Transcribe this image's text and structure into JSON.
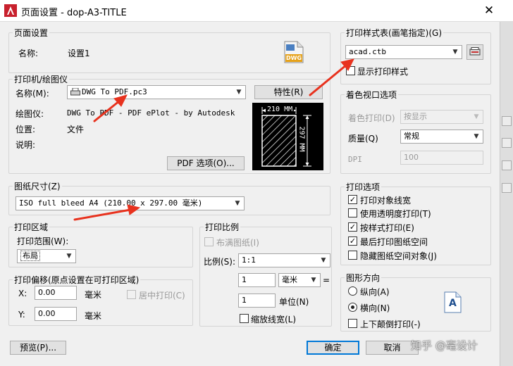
{
  "window": {
    "title": "页面设置 - dop-A3-TITLE",
    "close_glyph": "✕"
  },
  "page_setup": {
    "legend": "页面设置",
    "name_label": "名称:",
    "name_value": "设置1",
    "icon_badge": "DWG"
  },
  "printer": {
    "legend": "打印机/绘图仪",
    "name_label": "名称(M):",
    "name_value": "DWG To PDF.pc3",
    "properties_button": "特性(R)",
    "plotter_label": "绘图仪:",
    "plotter_value": "DWG To PDF - PDF ePlot - by Autodesk",
    "location_label": "位置:",
    "location_value": "文件",
    "description_label": "说明:",
    "pdf_options_button": "PDF 选项(O)...",
    "preview_width": "210 MM",
    "preview_height": "297 MM"
  },
  "paper_size": {
    "legend": "图纸尺寸(Z)",
    "value": "ISO full bleed A4 (210.00 x 297.00 毫米)"
  },
  "plot_area": {
    "legend": "打印区域",
    "range_label": "打印范围(W):",
    "range_value": "布局"
  },
  "plot_offset": {
    "legend": "打印偏移(原点设置在可打印区域)",
    "x_label": "X:",
    "x_value": "0.00",
    "x_unit": "毫米",
    "y_label": "Y:",
    "y_value": "0.00",
    "y_unit": "毫米",
    "center_label": "居中打印(C)"
  },
  "plot_scale": {
    "legend": "打印比例",
    "fit_label": "布满图纸(I)",
    "scale_label": "比例(S):",
    "scale_value": "1:1",
    "value1": "1",
    "unit_select": "毫米",
    "equals": "=",
    "value2": "1",
    "unit_label": "单位(N)",
    "scale_lineweights_label": "缩放线宽(L)"
  },
  "plot_style_table": {
    "legend": "打印样式表(画笔指定)(G)",
    "value": "acad.ctb",
    "display_label": "显示打印样式"
  },
  "shaded_viewport": {
    "legend": "着色视口选项",
    "shade_label": "着色打印(D)",
    "shade_value": "按显示",
    "quality_label": "质量(Q)",
    "quality_value": "常规",
    "dpi_label": "DPI",
    "dpi_value": "100"
  },
  "plot_options": {
    "legend": "打印选项",
    "items": [
      {
        "label": "打印对象线宽",
        "checked": "✓"
      },
      {
        "label": "使用透明度打印(T)",
        "checked": ""
      },
      {
        "label": "按样式打印(E)",
        "checked": "✓"
      },
      {
        "label": "最后打印图纸空间",
        "checked": "✓"
      },
      {
        "label": "隐藏图纸空间对象(J)",
        "checked": ""
      }
    ]
  },
  "drawing_orientation": {
    "legend": "图形方向",
    "portrait_label": "纵向(A)",
    "landscape_label": "横向(N)",
    "upside_down_label": "上下颠倒打印(-)",
    "icon_letter": "A"
  },
  "footer": {
    "preview_button": "预览(P)...",
    "ok_button": "确定",
    "cancel_button": "取消"
  },
  "watermark": "知乎 @毫设计",
  "colors": {
    "annotation_arrow": "#e8321e",
    "accent": "#0078d7"
  }
}
